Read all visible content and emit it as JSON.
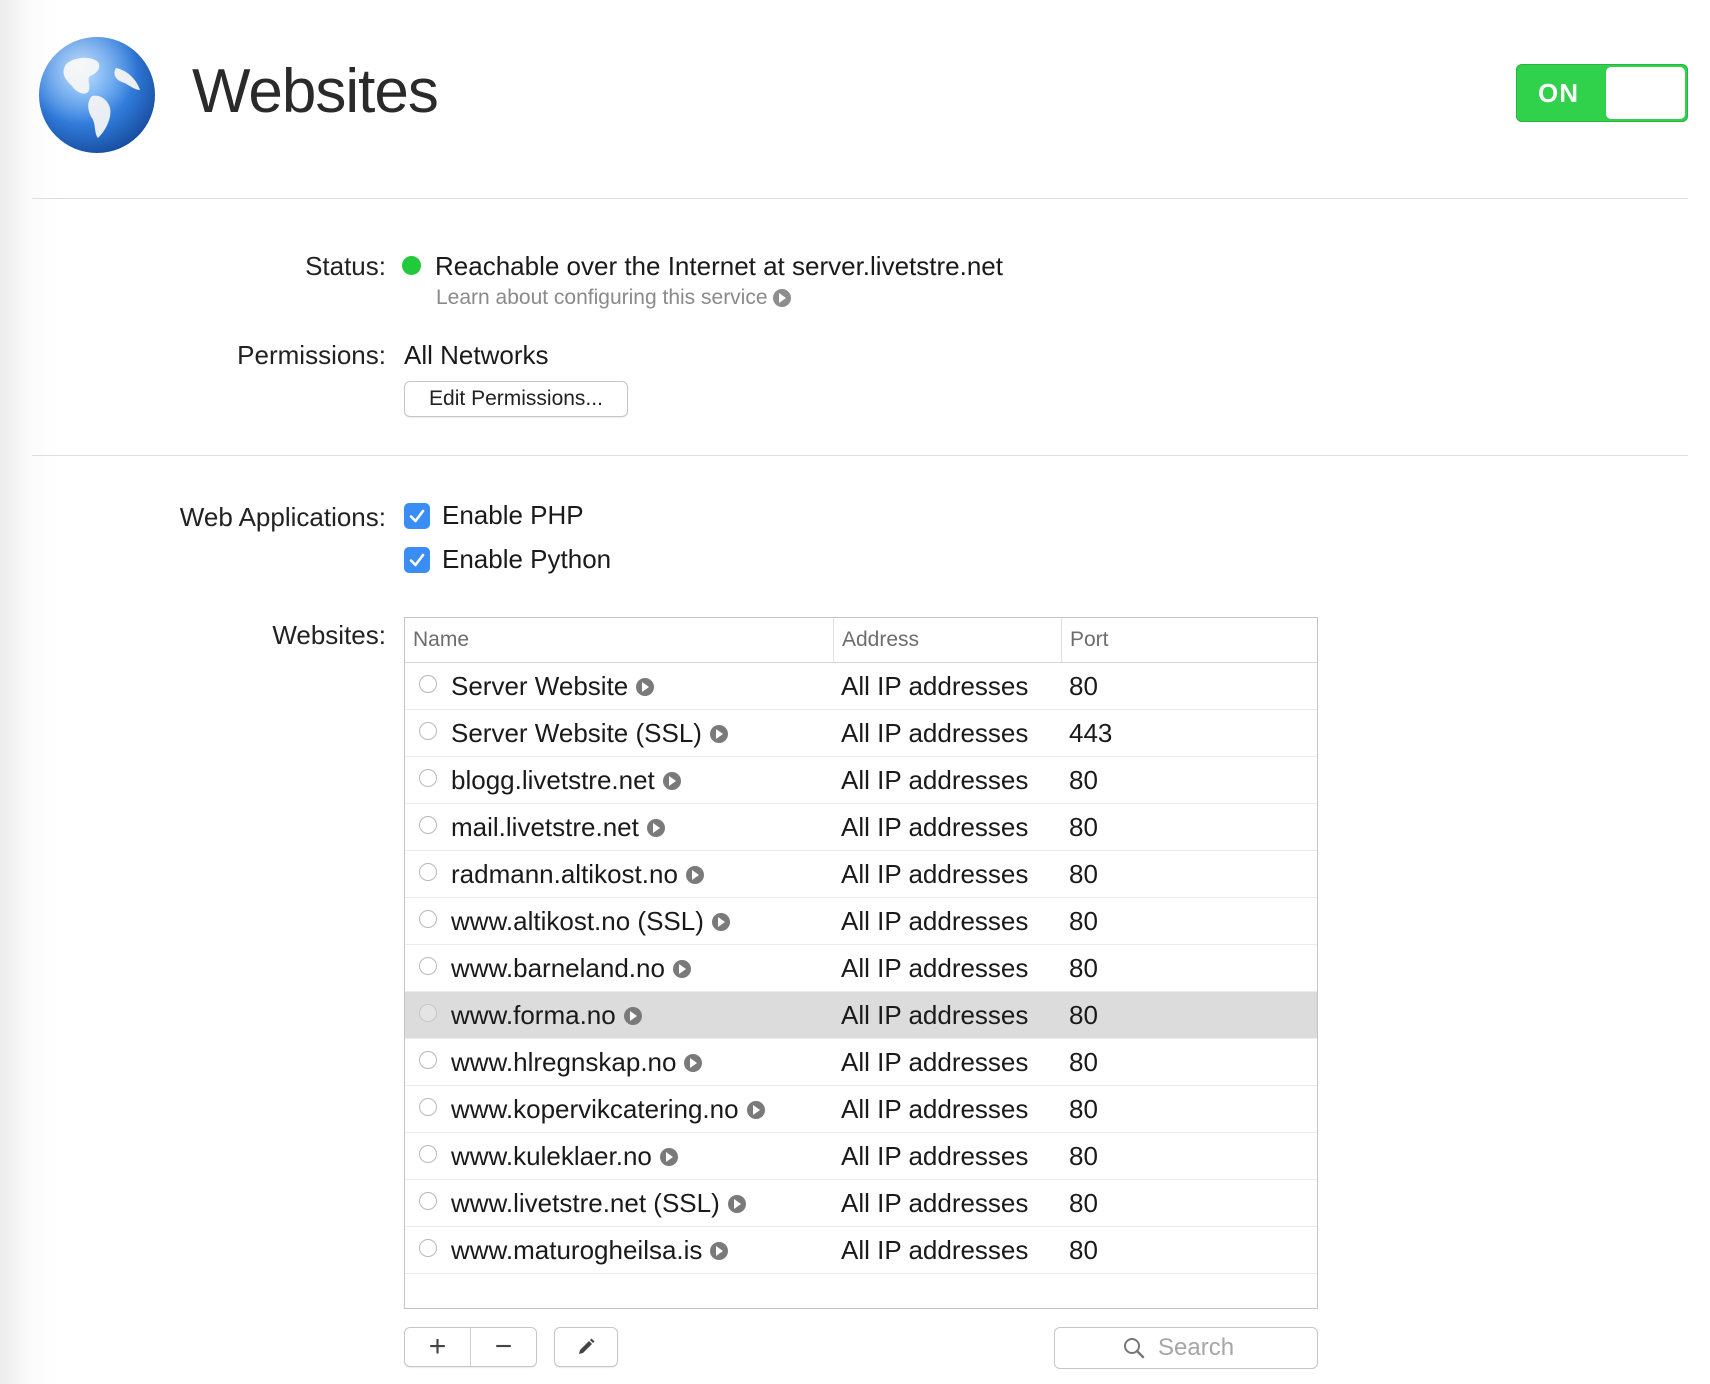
{
  "header": {
    "title": "Websites",
    "toggle_label": "ON",
    "toggle_state": "on"
  },
  "status": {
    "label": "Status:",
    "text": "Reachable over the Internet at server.livetstre.net",
    "learn_link": "Learn about configuring this service",
    "indicator_color": "#22c93a"
  },
  "permissions": {
    "label": "Permissions:",
    "value": "All Networks",
    "edit_button": "Edit Permissions..."
  },
  "web_apps": {
    "label": "Web Applications:",
    "options": [
      {
        "label": "Enable PHP",
        "checked": true
      },
      {
        "label": "Enable Python",
        "checked": true
      }
    ]
  },
  "websites": {
    "label": "Websites:",
    "columns": [
      "Name",
      "Address",
      "Port"
    ],
    "rows": [
      {
        "name": "Server Website",
        "address": "All IP addresses",
        "port": "80"
      },
      {
        "name": "Server Website (SSL)",
        "address": "All IP addresses",
        "port": "443"
      },
      {
        "name": "blogg.livetstre.net",
        "address": "All IP addresses",
        "port": "80"
      },
      {
        "name": "mail.livetstre.net",
        "address": "All IP addresses",
        "port": "80"
      },
      {
        "name": "radmann.altikost.no",
        "address": "All IP addresses",
        "port": "80"
      },
      {
        "name": "www.altikost.no (SSL)",
        "address": "All IP addresses",
        "port": "80"
      },
      {
        "name": "www.barneland.no",
        "address": "All IP addresses",
        "port": "80"
      },
      {
        "name": "www.forma.no",
        "address": "All IP addresses",
        "port": "80",
        "selected": true
      },
      {
        "name": "www.hlregnskap.no",
        "address": "All IP addresses",
        "port": "80"
      },
      {
        "name": "www.kopervikcatering.no",
        "address": "All IP addresses",
        "port": "80"
      },
      {
        "name": "www.kuleklaer.no",
        "address": "All IP addresses",
        "port": "80"
      },
      {
        "name": "www.livetstre.net (SSL)",
        "address": "All IP addresses",
        "port": "80"
      },
      {
        "name": "www.maturogheilsa.is",
        "address": "All IP addresses",
        "port": "80"
      }
    ]
  },
  "toolbar": {
    "add_label": "+",
    "remove_label": "−",
    "search_placeholder": "Search"
  },
  "colors": {
    "toggle_on": "#2fd24a",
    "checkbox": "#3a8df5",
    "selected_row": "#dcdcdc"
  }
}
